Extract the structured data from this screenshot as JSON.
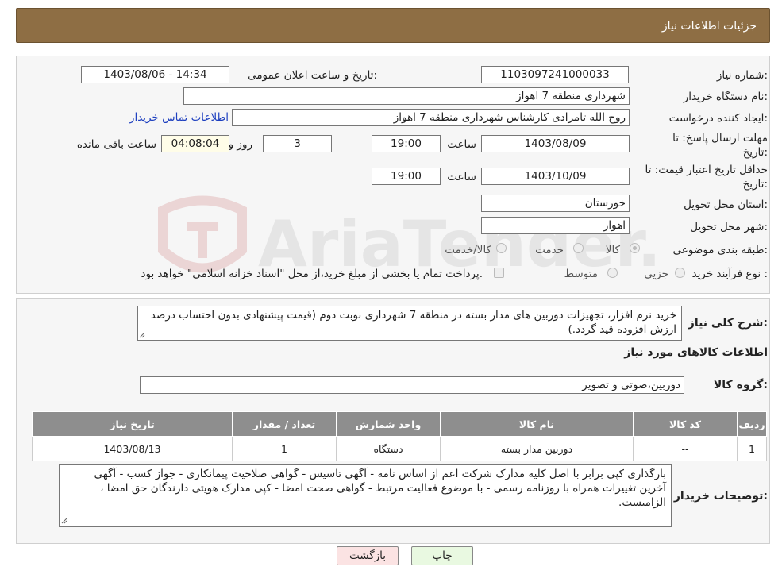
{
  "header": {
    "title": "جزئیات اطلاعات نیاز"
  },
  "form": {
    "need_number_label": "شماره نیاز:",
    "need_number": "1103097241000033",
    "announce_label": "تاریخ و ساعت اعلان عمومی:",
    "announce_value": "1403/08/06 - 14:34",
    "buyer_org_label": "نام دستگاه خریدار:",
    "buyer_org": "شهرداری منطقه 7 اهواز",
    "creator_label": "ایجاد کننده درخواست:",
    "creator": "روح الله تامرادی کارشناس شهرداری منطقه 7 اهواز",
    "buyer_contact_link": "اطلاعات تماس خریدار",
    "reply_deadline_label_1": "مهلت ارسال پاسخ: تا",
    "reply_deadline_label_2": "تاریخ:",
    "reply_date": "1403/08/09",
    "time_label": "ساعت",
    "reply_time": "19:00",
    "days_value": "3",
    "days_label": "روز و",
    "remaining_time": "04:08:04",
    "remaining_label": "ساعت باقی مانده",
    "price_validity_label_1": "حداقل تاریخ اعتبار قیمت: تا",
    "price_validity_label_2": "تاریخ:",
    "price_validity_date": "1403/10/09",
    "price_validity_time": "19:00",
    "province_label": "استان محل تحویل:",
    "province": "خوزستان",
    "city_label": "شهر محل تحویل:",
    "city": "اهواز",
    "category_label": "طبقه بندی موضوعی:",
    "category_options": [
      "کالا",
      "خدمت",
      "کالا/خدمت"
    ],
    "purchase_type_label": "نوع فرآیند خرید :",
    "purchase_options": [
      "جزیی",
      "متوسط"
    ],
    "purchase_note": "پرداخت تمام یا بخشی از مبلغ خرید،از محل \"اسناد خزانه اسلامی\" خواهد بود."
  },
  "description": {
    "label": "شرح کلی نیاز:",
    "text": "خرید نرم افزار، تجهیزات دوربین های مدار بسته در منطقه 7 شهرداری نوبت دوم (قیمت پیشنهادی بدون احتساب درصد ارزش افزوده قید گردد.)"
  },
  "goods": {
    "section_title": "اطلاعات کالاهای مورد نیاز",
    "group_label": "گروه کالا:",
    "group_value": "دوربین،صوتی و تصویر",
    "columns": [
      "ردیف",
      "کد کالا",
      "نام کالا",
      "واحد شمارش",
      "تعداد / مقدار",
      "تاریخ نیاز"
    ],
    "rows": [
      [
        "1",
        "--",
        "دوربین مدار بسته",
        "دستگاه",
        "1",
        "1403/08/13"
      ]
    ]
  },
  "buyer_notes": {
    "label": "توضیحات خریدار:",
    "text": "بارگذاری کپی برابر با اصل کلیه مدارک شرکت اعم از اساس نامه - آگهی تاسیس - گواهی صلاحیت پیمانکاری - جواز کسب - آگهی آخرین تغییرات همراه با روزنامه رسمی - با موضوع فعالیت مرتبط - گواهی صحت امضا - کپی مدارک هویتی دارندگان حق امضا ، الزامیست."
  },
  "buttons": {
    "print": "چاپ",
    "back": "بازگشت"
  },
  "watermark": {
    "text": "AriaTender.neT"
  },
  "colors": {
    "header_bg": "#8e6e44",
    "link": "#1d3fbf",
    "table_header": "#8e8e8e",
    "back_button_bg": "#fbe3e3",
    "print_button_bg": "#e9f9e1"
  }
}
